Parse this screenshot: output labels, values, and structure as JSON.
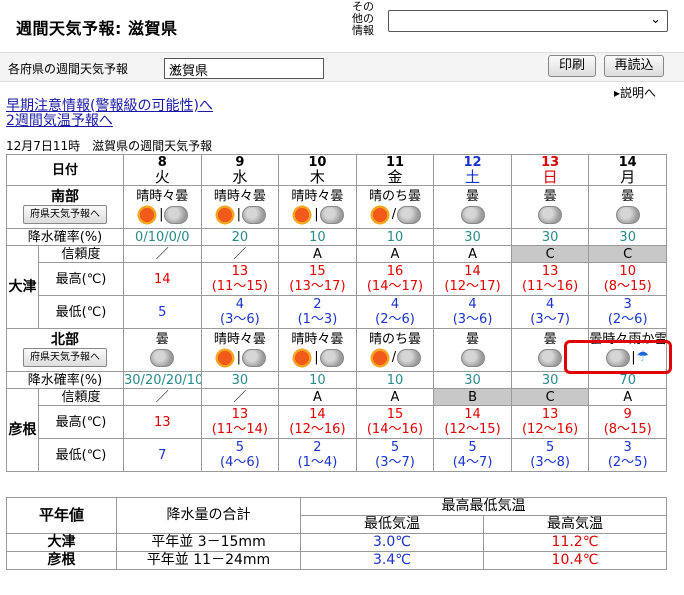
{
  "header": {
    "title": "週間天気予報: 滋賀県",
    "other_label": [
      "その",
      "他の",
      "情報"
    ]
  },
  "toolbar": {
    "pref_label": "各府県の週間天気予報",
    "pref_selected": "滋賀県",
    "print_label": "印刷",
    "reload_label": "再読込",
    "help_label": "説明へ"
  },
  "links": {
    "early_warning": "早期注意情報(警報級の可能性)へ",
    "two_week": "2週間気温予報へ"
  },
  "issued": "12月7日11時　滋賀県の週間天気予報",
  "forecast": {
    "date_header": "日付",
    "days": [
      {
        "date": "8",
        "dow": "火",
        "color": ""
      },
      {
        "date": "9",
        "dow": "水",
        "color": ""
      },
      {
        "date": "10",
        "dow": "木",
        "color": ""
      },
      {
        "date": "11",
        "dow": "金",
        "color": ""
      },
      {
        "date": "12",
        "dow": "土",
        "color": "blue"
      },
      {
        "date": "13",
        "dow": "日",
        "color": "red"
      },
      {
        "date": "14",
        "dow": "月",
        "color": ""
      }
    ],
    "pref_forecast_button": "府県天気予報へ",
    "precip_label": "降水確率(%)",
    "reliability_label": "信頼度",
    "max_label": "最高(℃)",
    "min_label": "最低(℃)",
    "south": {
      "name": "南部",
      "city": "大津",
      "weather": [
        "晴時々曇",
        "晴時々曇",
        "晴時々曇",
        "晴のち曇",
        "曇",
        "曇",
        "曇"
      ],
      "icons": [
        [
          "sun-icon",
          "cloud-icon"
        ],
        [
          "sun-icon",
          "cloud-icon"
        ],
        [
          "sun-icon",
          "cloud-icon"
        ],
        [
          "sun-icon",
          "cloud-icon"
        ],
        [
          "cloud-icon"
        ],
        [
          "cloud-icon"
        ],
        [
          "cloud-icon"
        ]
      ],
      "precip": [
        "0/10/0/0",
        "20",
        "10",
        "10",
        "30",
        "30",
        "30"
      ],
      "reliability": [
        "／",
        "／",
        "A",
        "A",
        "A",
        "C",
        "C"
      ],
      "max": [
        "14",
        "13",
        "15",
        "16",
        "14",
        "13",
        "10"
      ],
      "max_range": [
        "",
        "(11～15)",
        "(13～17)",
        "(14～17)",
        "(12～17)",
        "(11～16)",
        "(8～15)"
      ],
      "min": [
        "5",
        "4",
        "2",
        "4",
        "4",
        "4",
        "3"
      ],
      "min_range": [
        "",
        "(3～6)",
        "(1～3)",
        "(2～6)",
        "(3～6)",
        "(3～7)",
        "(2～6)"
      ]
    },
    "north": {
      "name": "北部",
      "city": "彦根",
      "weather": [
        "曇",
        "晴時々曇",
        "晴時々曇",
        "晴のち曇",
        "曇",
        "曇",
        "曇時々雨か雪"
      ],
      "icons": [
        [
          "cloud-icon"
        ],
        [
          "sun-icon",
          "cloud-icon"
        ],
        [
          "sun-icon",
          "cloud-icon"
        ],
        [
          "sun-icon",
          "cloud-icon"
        ],
        [
          "cloud-icon"
        ],
        [
          "cloud-icon"
        ],
        [
          "cloud-icon",
          "umbrella-icon"
        ]
      ],
      "precip": [
        "30/20/20/10",
        "30",
        "10",
        "10",
        "30",
        "30",
        "70"
      ],
      "reliability": [
        "／",
        "／",
        "A",
        "A",
        "B",
        "C",
        "A"
      ],
      "max": [
        "13",
        "13",
        "14",
        "15",
        "14",
        "13",
        "9"
      ],
      "max_range": [
        "",
        "(11～14)",
        "(12～16)",
        "(14～16)",
        "(12～15)",
        "(12～16)",
        "(8～15)"
      ],
      "min": [
        "7",
        "5",
        "2",
        "5",
        "5",
        "5",
        "3"
      ],
      "min_range": [
        "",
        "(4～6)",
        "(1～4)",
        "(3～7)",
        "(4～7)",
        "(3～8)",
        "(2～5)"
      ]
    }
  },
  "normals": {
    "title": "平年値",
    "precip_total": "降水量の合計",
    "temp_header": "最高最低気温",
    "min_header": "最低気温",
    "max_header": "最高気温",
    "rows": [
      {
        "city": "大津",
        "precip": "平年並 3－15mm",
        "min": "3.0℃",
        "max": "11.2℃"
      },
      {
        "city": "彦根",
        "precip": "平年並 11－24mm",
        "min": "3.4℃",
        "max": "10.4℃"
      }
    ]
  },
  "colors": {
    "link": "#1a1aa6",
    "max_temp": "#e00000",
    "min_temp": "#1a33cc",
    "precip": "#2a8a8a",
    "highlight": "#e00000"
  }
}
